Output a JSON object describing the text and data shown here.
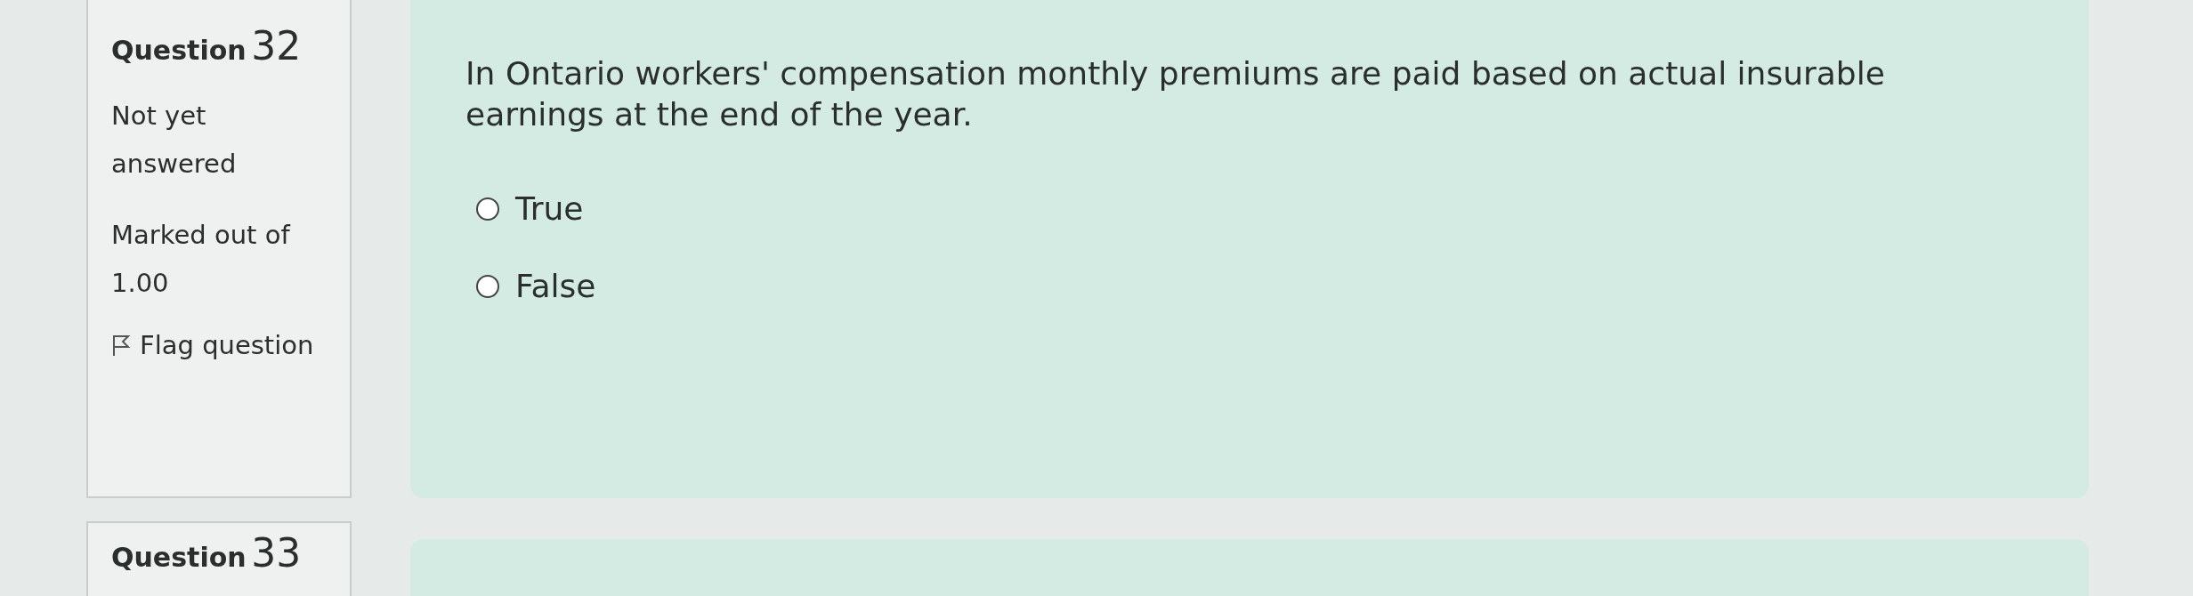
{
  "questions": [
    {
      "label": "Question",
      "number": "32",
      "state": "Not yet answered",
      "marks": "Marked out of 1.00",
      "flag": "Flag question",
      "text": "In Ontario workers' compensation monthly premiums are paid based on actual insurable earnings at the end of the year.",
      "options": [
        {
          "label": "True",
          "selected": false
        },
        {
          "label": "False",
          "selected": false
        }
      ]
    },
    {
      "label": "Question",
      "number": "33"
    }
  ]
}
